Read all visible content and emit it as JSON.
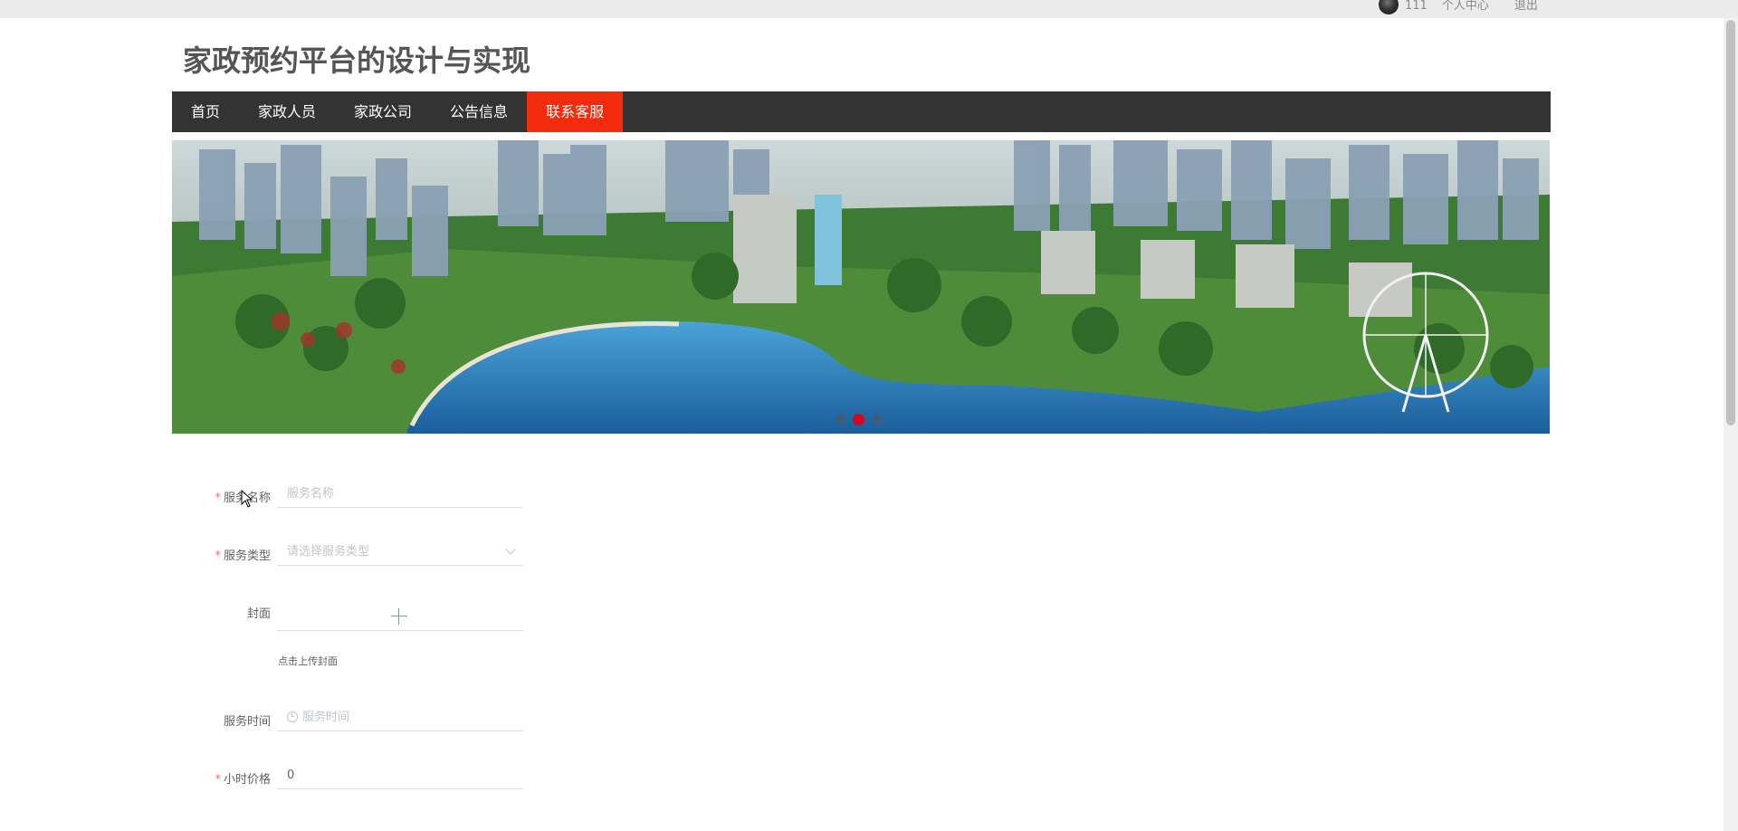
{
  "topbar": {
    "username": "111",
    "user_center": "个人中心",
    "logout": "退出"
  },
  "header": {
    "title": "家政预约平台的设计与实现"
  },
  "nav": {
    "items": [
      {
        "label": "首页",
        "active": false
      },
      {
        "label": "家政人员",
        "active": false
      },
      {
        "label": "家政公司",
        "active": false
      },
      {
        "label": "公告信息",
        "active": false
      },
      {
        "label": "联系客服",
        "active": true
      }
    ]
  },
  "banner": {
    "slide_count": 3,
    "active_slide": 2
  },
  "form": {
    "service_name": {
      "label": "服务名称",
      "placeholder": "服务名称",
      "required": true
    },
    "service_type": {
      "label": "服务类型",
      "placeholder": "请选择服务类型",
      "required": true
    },
    "cover": {
      "label": "封面",
      "hint": "点击上传封面",
      "required": false
    },
    "service_time": {
      "label": "服务时间",
      "placeholder": "服务时间",
      "required": false
    },
    "hourly_price": {
      "label": "小时价格",
      "value": "0",
      "required": true
    }
  },
  "colors": {
    "nav_bg": "#333333",
    "nav_active": "#f32b0d",
    "required_star": "#f56c6c",
    "dot_active": "#e60012"
  }
}
